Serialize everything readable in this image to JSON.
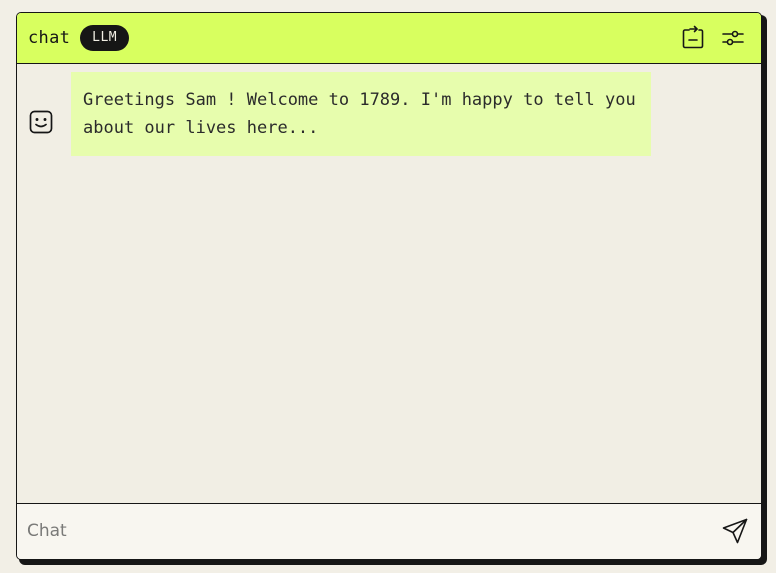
{
  "header": {
    "title": "chat",
    "badge": "LLM",
    "actions": [
      {
        "icon": "export-icon"
      },
      {
        "icon": "settings-sliders-icon"
      }
    ]
  },
  "messages": [
    {
      "sender_icon": "bot-face-icon",
      "text": "Greetings Sam ! Welcome to 1789. I'm happy to tell you about our lives here..."
    }
  ],
  "composer": {
    "placeholder": "Chat",
    "value": "",
    "send_icon": "send-icon"
  },
  "colors": {
    "accent": "#d8ff5f",
    "bubble": "#e7fdad",
    "background": "#f1eee4",
    "ink": "#161616"
  }
}
